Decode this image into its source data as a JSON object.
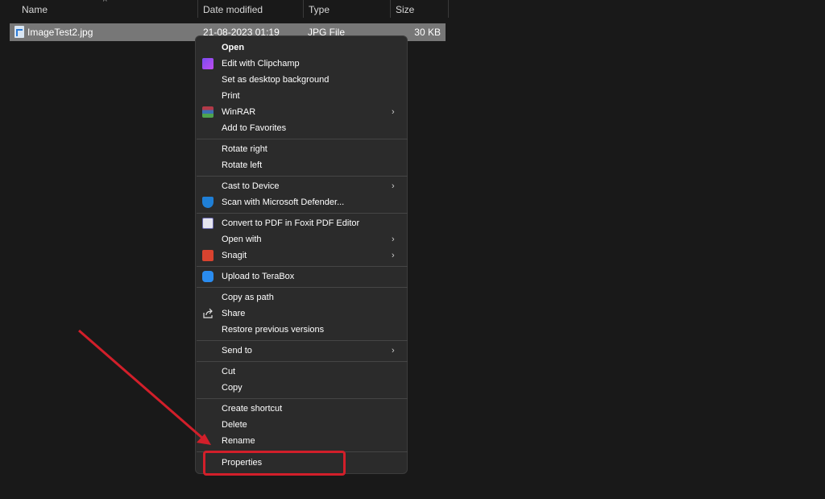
{
  "header": {
    "columns": [
      {
        "label": "Name"
      },
      {
        "label": "Date modified"
      },
      {
        "label": "Type"
      },
      {
        "label": "Size"
      }
    ],
    "sort_indicator": "^"
  },
  "file": {
    "name": "ImageTest2.jpg",
    "date_modified": "21-08-2023 01:19",
    "type": "JPG File",
    "size": "30 KB",
    "icon": "jpg-file-icon"
  },
  "menu": {
    "items": [
      {
        "label": "Open",
        "bold": true,
        "icon": null,
        "submenu": false
      },
      {
        "label": "Edit with Clipchamp",
        "icon": "clipchamp-icon",
        "submenu": false
      },
      {
        "label": "Set as desktop background",
        "icon": null,
        "submenu": false
      },
      {
        "label": "Print",
        "icon": null,
        "submenu": false
      },
      {
        "label": "WinRAR",
        "icon": "winrar-icon",
        "submenu": true
      },
      {
        "label": "Add to Favorites",
        "icon": null,
        "submenu": false
      },
      {
        "label": "Rotate right",
        "icon": null,
        "submenu": false
      },
      {
        "label": "Rotate left",
        "icon": null,
        "submenu": false
      },
      {
        "label": "Cast to Device",
        "icon": null,
        "submenu": true
      },
      {
        "label": "Scan with Microsoft Defender...",
        "icon": "defender-shield-icon",
        "submenu": false
      },
      {
        "label": "Convert to PDF in Foxit PDF Editor",
        "icon": "foxit-pdf-icon",
        "submenu": false
      },
      {
        "label": "Open with",
        "icon": null,
        "submenu": true
      },
      {
        "label": "Snagit",
        "icon": "snagit-icon",
        "submenu": true
      },
      {
        "label": "Upload to TeraBox",
        "icon": "terabox-icon",
        "submenu": false
      },
      {
        "label": "Copy as path",
        "icon": null,
        "submenu": false
      },
      {
        "label": "Share",
        "icon": "share-icon",
        "submenu": false
      },
      {
        "label": "Restore previous versions",
        "icon": null,
        "submenu": false
      },
      {
        "label": "Send to",
        "icon": null,
        "submenu": true
      },
      {
        "label": "Cut",
        "icon": null,
        "submenu": false
      },
      {
        "label": "Copy",
        "icon": null,
        "submenu": false
      },
      {
        "label": "Create shortcut",
        "icon": null,
        "submenu": false
      },
      {
        "label": "Delete",
        "icon": null,
        "submenu": false
      },
      {
        "label": "Rename",
        "icon": null,
        "submenu": false
      },
      {
        "label": "Properties",
        "icon": null,
        "submenu": false
      }
    ],
    "submenu_glyph": "›"
  },
  "annotation": {
    "color": "#d21f2a",
    "target": "Properties"
  },
  "colors": {
    "background": "#191919",
    "menu_bg": "#2b2b2b",
    "selection": "#777777"
  }
}
